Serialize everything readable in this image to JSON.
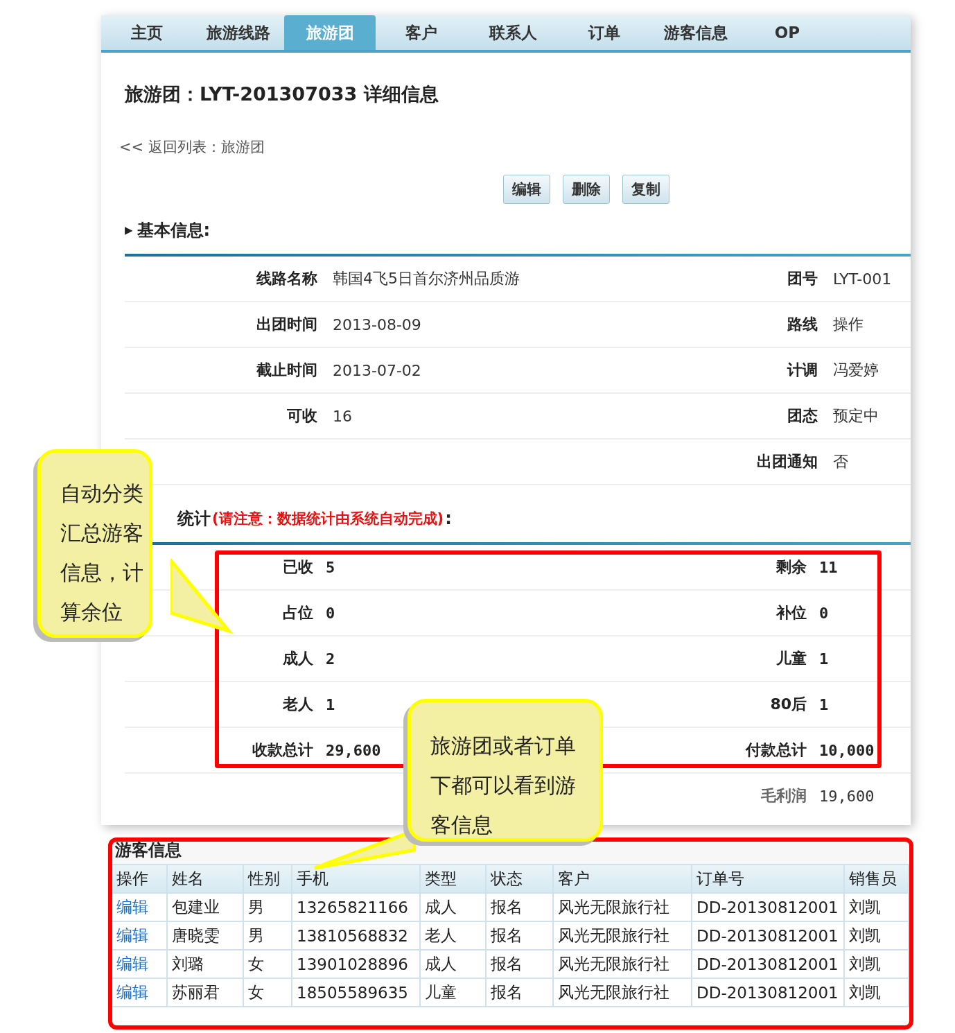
{
  "nav_tabs": [
    {
      "label": "主页",
      "selected": false
    },
    {
      "label": "旅游线路",
      "selected": false
    },
    {
      "label": "旅游团",
      "selected": true
    },
    {
      "label": "客户",
      "selected": false
    },
    {
      "label": "联系人",
      "selected": false
    },
    {
      "label": "订单",
      "selected": false
    },
    {
      "label": "游客信息",
      "selected": false
    },
    {
      "label": "OP",
      "selected": false
    }
  ],
  "page_title": "旅游团：LYT-201307033 详细信息",
  "back_link": "<< 返回列表：旅游团",
  "buttons": [
    "编辑",
    "删除",
    "复制"
  ],
  "basic_info": {
    "heading": "基本信息:",
    "marker": "▶",
    "rows": [
      {
        "left_label": "线路名称",
        "left_value": "韩国4飞5日首尔济州品质游",
        "right_label": "团号",
        "right_value": "LYT-001"
      },
      {
        "left_label": "出团时间",
        "left_value": "2013-08-09",
        "right_label": "路线",
        "right_value": "操作"
      },
      {
        "left_label": "截止时间",
        "left_value": "2013-07-02",
        "right_label": "计调",
        "right_value": "冯爱婷"
      },
      {
        "left_label": "可收",
        "left_value": "16",
        "right_label": "团态",
        "right_value": "预定中"
      },
      {
        "right_label": "出团通知",
        "right_value": "否"
      }
    ]
  },
  "statistics": {
    "heading": "统计",
    "note": "(请注意：数据统计由系统自动完成)",
    "colon": ":",
    "rows": [
      {
        "left_label": "已收",
        "left_value": "5",
        "right_label": "剩余",
        "right_value": "11"
      },
      {
        "left_label": "占位",
        "left_value": "0",
        "right_label": "补位",
        "right_value": "0"
      },
      {
        "left_label": "成人",
        "left_value": "2",
        "right_label": "儿童",
        "right_value": "1"
      },
      {
        "left_label": "老人",
        "left_value": "1",
        "right_label": "80后",
        "right_value": "1"
      },
      {
        "left_label": "收款总计",
        "left_value": "29,600",
        "right_label": "付款总计",
        "right_value": "10,000"
      }
    ],
    "gross_profit": {
      "label": "毛利润",
      "value": "19,600"
    }
  },
  "visitor_table": {
    "title": "游客信息",
    "columns": [
      "操作",
      "姓名",
      "性别",
      "手机",
      "类型",
      "状态",
      "客户",
      "订单号",
      "销售员"
    ],
    "rows": [
      {
        "cells": [
          "编辑",
          "包建业",
          "男",
          "13265821166",
          "成人",
          "报名",
          "风光无限旅行社",
          "DD-20130812001",
          "刘凯"
        ]
      },
      {
        "cells": [
          "编辑",
          "唐晓雯",
          "男",
          "13810568832",
          "老人",
          "报名",
          "风光无限旅行社",
          "DD-20130812001",
          "刘凯"
        ]
      },
      {
        "cells": [
          "编辑",
          "刘璐",
          "女",
          "13901028896",
          "成人",
          "报名",
          "风光无限旅行社",
          "DD-20130812001",
          "刘凯"
        ]
      },
      {
        "cells": [
          "编辑",
          "苏丽君",
          "女",
          "18505589635",
          "儿童",
          "报名",
          "风光无限旅行社",
          "DD-20130812001",
          "刘凯"
        ]
      }
    ]
  },
  "callouts": [
    "自动分类汇总游客信息，计算余位",
    "旅游团或者订单下都可以看到游客信息"
  ]
}
